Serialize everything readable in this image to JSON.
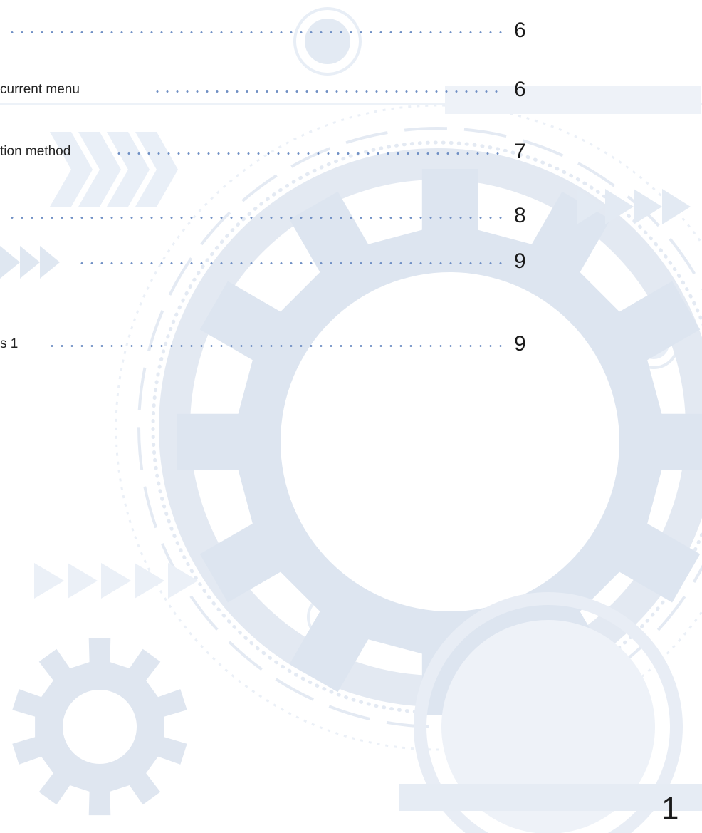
{
  "toc": {
    "entries": [
      {
        "label": "",
        "page": "6"
      },
      {
        "label": "current menu",
        "page": "6"
      },
      {
        "label": "tion method",
        "page": "7"
      },
      {
        "label": "",
        "page": "8"
      },
      {
        "label": "",
        "page": "9"
      },
      {
        "label": "s 1",
        "page": "9"
      }
    ]
  },
  "page_number": "1",
  "colors": {
    "background_art": "#e6ecf4",
    "background_art_dark": "#d7e0ec",
    "dot_leader": "#6f8fc4",
    "text": "#1a1a1a"
  },
  "decorations": {
    "icons": [
      "large-gear-icon",
      "small-gear-icon",
      "chevron-arrows-icon",
      "concentric-circle-icon"
    ]
  }
}
